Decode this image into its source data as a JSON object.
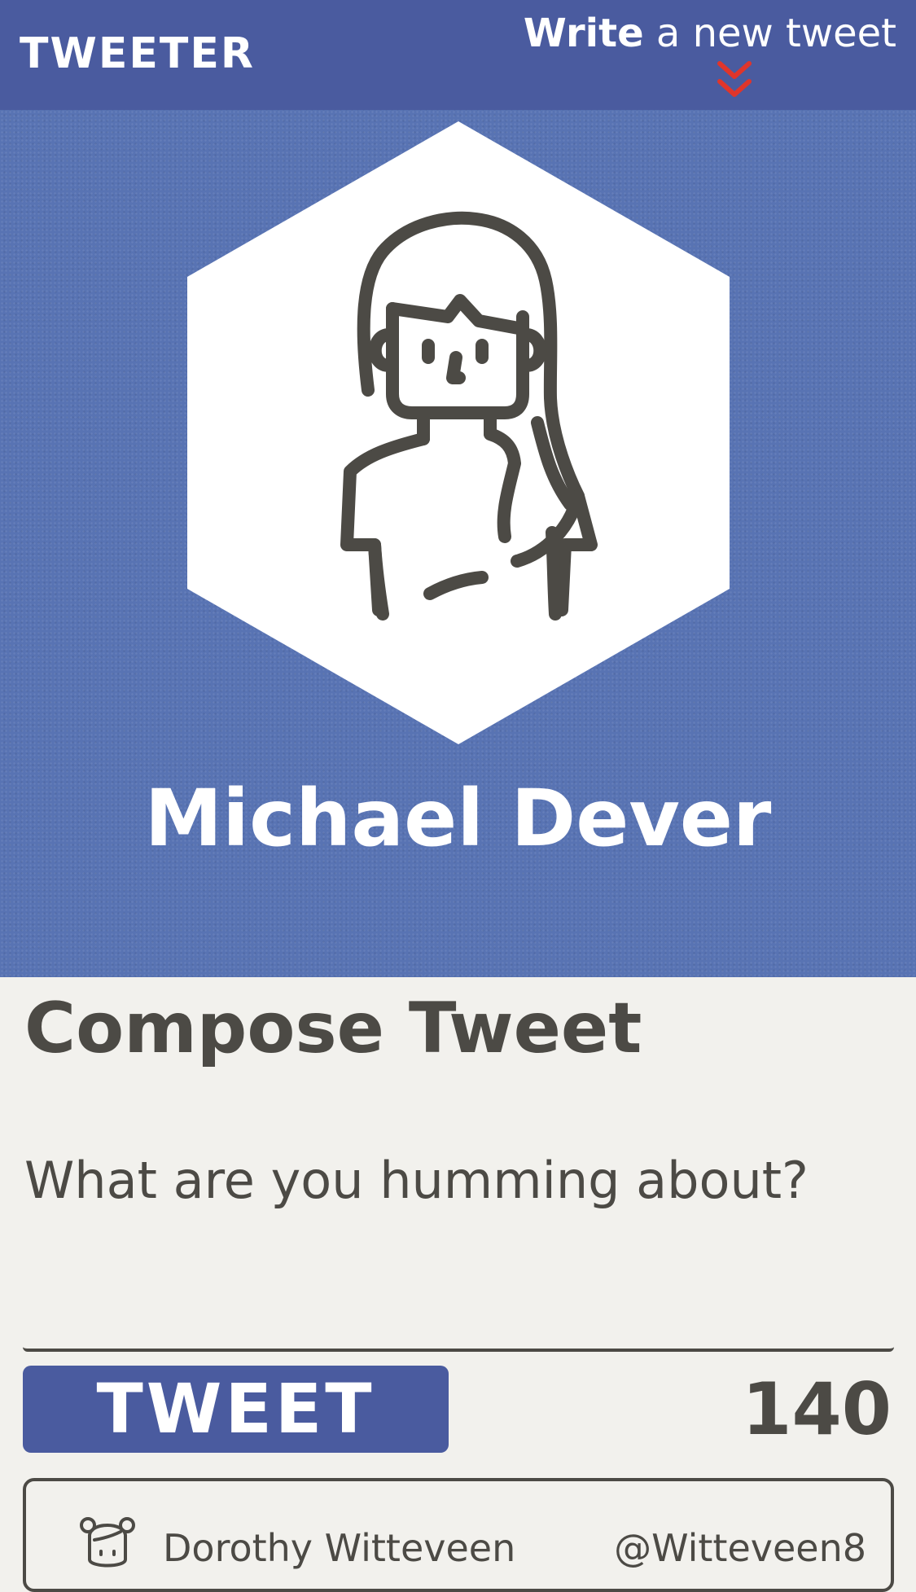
{
  "nav": {
    "brand": "TWEETER",
    "write_strong": "Write",
    "write_rest": " a new tweet",
    "chevron_icon": "double-chevron-down-icon",
    "chevron_color": "#e0352b"
  },
  "profile": {
    "name": "Michael Dever",
    "avatar_icon": "woman-avatar-icon"
  },
  "compose": {
    "title": "Compose Tweet",
    "prompt": "What are you humming about?",
    "textarea_value": "",
    "button_label": "TWEET",
    "char_count": "140"
  },
  "tweets": [
    {
      "name": "Dorothy Witteveen",
      "handle": "@Witteveen8",
      "avatar_icon": "girl-avatar-icon"
    }
  ],
  "colors": {
    "primary": "#4a5b9f",
    "hero_bg": "#5873b3",
    "text": "#4c4a45",
    "page_bg": "#f2f1ed",
    "accent": "#e0352b"
  }
}
